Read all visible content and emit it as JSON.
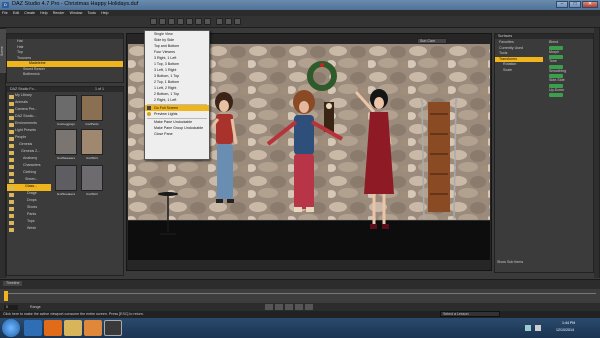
{
  "window": {
    "title": "DAZ Studio 4.7 Pro - Christmas Happy Holidays.duf",
    "buttons": {
      "minimize": "–",
      "maximize": "□",
      "close": "✕"
    }
  },
  "menubar": [
    "File",
    "Edit",
    "Create",
    "Help",
    "Render",
    "Window",
    "Tools",
    "Help"
  ],
  "scene_panel": {
    "tab": "Scene",
    "items": [
      {
        "label": "Hat",
        "selected": false
      },
      {
        "label": "Hair",
        "selected": false
      },
      {
        "label": "Top",
        "selected": false
      },
      {
        "label": "Trousers",
        "selected": false
      },
      {
        "label": "Madeleine",
        "selected": true
      },
      {
        "label": "Sword Bearer",
        "selected": false
      },
      {
        "label": "Bottleneck",
        "selected": false
      }
    ]
  },
  "content_panel": {
    "header": "DAZ Studio Fo...",
    "page": "1 of 1",
    "folders": [
      {
        "label": "My Library",
        "selected": false
      },
      {
        "label": "Animals",
        "selected": false
      },
      {
        "label": "Camera Pre...",
        "selected": false
      },
      {
        "label": "DAZ Studio...",
        "selected": false
      },
      {
        "label": "Environments",
        "selected": false
      },
      {
        "label": "Light Presets",
        "selected": false
      },
      {
        "label": "People",
        "selected": false
      },
      {
        "label": "Genesis",
        "selected": false
      },
      {
        "label": "Genesis 2...",
        "selected": false
      },
      {
        "label": "Anatomy",
        "selected": false
      },
      {
        "label": "Characters",
        "selected": false
      },
      {
        "label": "Clothing",
        "selected": false
      },
      {
        "label": "Sheen...",
        "selected": false
      },
      {
        "label": "Glass...",
        "selected": true
      },
      {
        "label": "Drage",
        "selected": false
      },
      {
        "label": "Drops",
        "selected": false
      },
      {
        "label": "Shoes",
        "selected": false
      },
      {
        "label": "Pants",
        "selected": false
      },
      {
        "label": "Tops",
        "selected": false
      },
      {
        "label": "Wesh",
        "selected": false
      }
    ],
    "thumbs": [
      "Gx2Leggings",
      "Gx2Pants",
      "Gx2Sweaters",
      "Gx2Shirt",
      "Gx2Sneakers",
      "Gx2Shirt"
    ]
  },
  "view_menu": {
    "items": [
      {
        "label": "Single View",
        "type": "item"
      },
      {
        "label": "Side by Side",
        "type": "item"
      },
      {
        "label": "Top and Bottom",
        "type": "item"
      },
      {
        "label": "Four Viewers",
        "type": "item"
      },
      {
        "label": "3 Right, 1 Left",
        "type": "item"
      },
      {
        "label": "1 Top, 3 Bottom",
        "type": "item"
      },
      {
        "label": "3 Left, 1 Right",
        "type": "item"
      },
      {
        "label": "3 Bottom, 1 Top",
        "type": "item"
      },
      {
        "label": "2 Top, 1 Bottom",
        "type": "item"
      },
      {
        "label": "1 Left, 2 Right",
        "type": "item"
      },
      {
        "label": "2 Bottom, 1 Top",
        "type": "item"
      },
      {
        "label": "2 Right, 1 Left",
        "type": "item"
      },
      {
        "label": "Go Full Screen",
        "type": "highlight"
      },
      {
        "label": "Preview Lights",
        "type": "check"
      },
      {
        "label": "Make Pane Undockable",
        "type": "item"
      },
      {
        "label": "Make Pane Group Undockable",
        "type": "item"
      },
      {
        "label": "Close Pane",
        "type": "item"
      }
    ]
  },
  "viewport": {
    "camera": "Sun Cam"
  },
  "right_panel": {
    "tab": "Surfaces",
    "header_items": [
      "Favorites",
      "Currently Used"
    ],
    "selected": "Transforms",
    "tree": [
      "Tools",
      "Transforms",
      "Rotation",
      "Scale"
    ],
    "params": [
      "Blend",
      "Morph",
      "Tone",
      "Smoothing",
      "Side-Side",
      "Up-Down"
    ],
    "footer": "Show Sub Items"
  },
  "timeline": {
    "label": "Timeline",
    "range": "Range",
    "frame": "0"
  },
  "statusbar": {
    "message": "Click here to make the active viewport consume the entire screen. Press [ESC] to return.",
    "lesson": "Select a Lesson"
  },
  "taskbar": {
    "time": "1:44 PM",
    "date": "12/10/2014"
  },
  "colors": {
    "accent": "#f0b51c",
    "panel": "#3b3b3b",
    "taskbar": "#1b3452"
  }
}
